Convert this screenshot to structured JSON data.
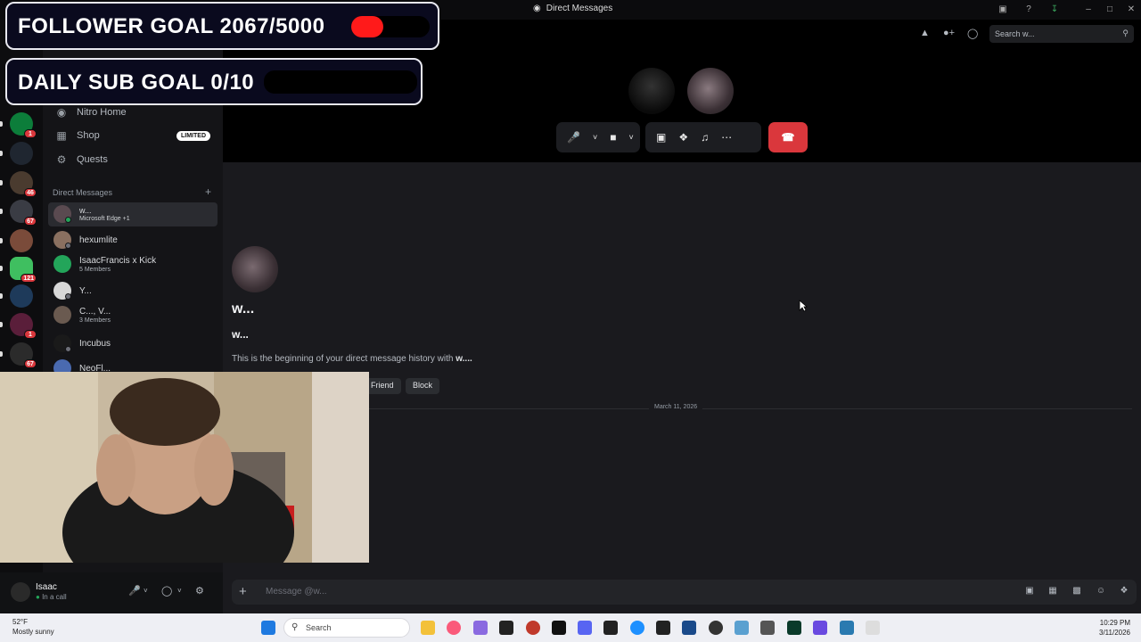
{
  "window": {
    "title": "Direct Messages"
  },
  "overlay": {
    "follower_goal": "FOLLOWER GOAL 2067/5000",
    "follower_progress": 0.41,
    "sub_goal": "DAILY SUB GOAL 0/10",
    "sub_progress": 0
  },
  "sidebar": {
    "nav": [
      {
        "label": "Nitro Home",
        "icon": "nitro-icon"
      },
      {
        "label": "Shop",
        "icon": "shop-icon",
        "badge": "LIMITED"
      },
      {
        "label": "Quests",
        "icon": "quests-icon"
      }
    ],
    "dm_header": "Direct Messages",
    "dms": [
      {
        "name": "w...",
        "sub": "Microsoft Edge +1",
        "active": true
      },
      {
        "name": "hexumlite",
        "sub": ""
      },
      {
        "name": "IsaacFrancis x Kick",
        "sub": "5 Members"
      },
      {
        "name": "Y...",
        "sub": ""
      },
      {
        "name": "C..., V...",
        "sub": "3 Members"
      },
      {
        "name": "Incubus",
        "sub": ""
      },
      {
        "name": "NeoFl...",
        "sub": ""
      }
    ]
  },
  "server_badges": [
    "1",
    "46",
    "67",
    "121",
    "1",
    "67"
  ],
  "call": {
    "search_placeholder": "Search w...",
    "end_call_icon": "hang-up-icon"
  },
  "chat": {
    "display_name": "w...",
    "username": "w...",
    "intro_prefix": "This is the beginning of your direct message history with ",
    "intro_user": "w....",
    "buttons": [
      "Friend",
      "Block"
    ],
    "date_divider": "March 11, 2026",
    "composer_placeholder": "Message @w..."
  },
  "user_panel": {
    "name": "Isaac",
    "status": "In a call"
  },
  "taskbar": {
    "weather_temp": "52°F",
    "weather_desc": "Mostly sunny",
    "search_label": "Search",
    "time": "10:29 PM",
    "date": "3/11/2026"
  },
  "colors": {
    "accent_red": "#da373c",
    "goal_fill": "#ff1a1a",
    "online_green": "#23a55a"
  }
}
